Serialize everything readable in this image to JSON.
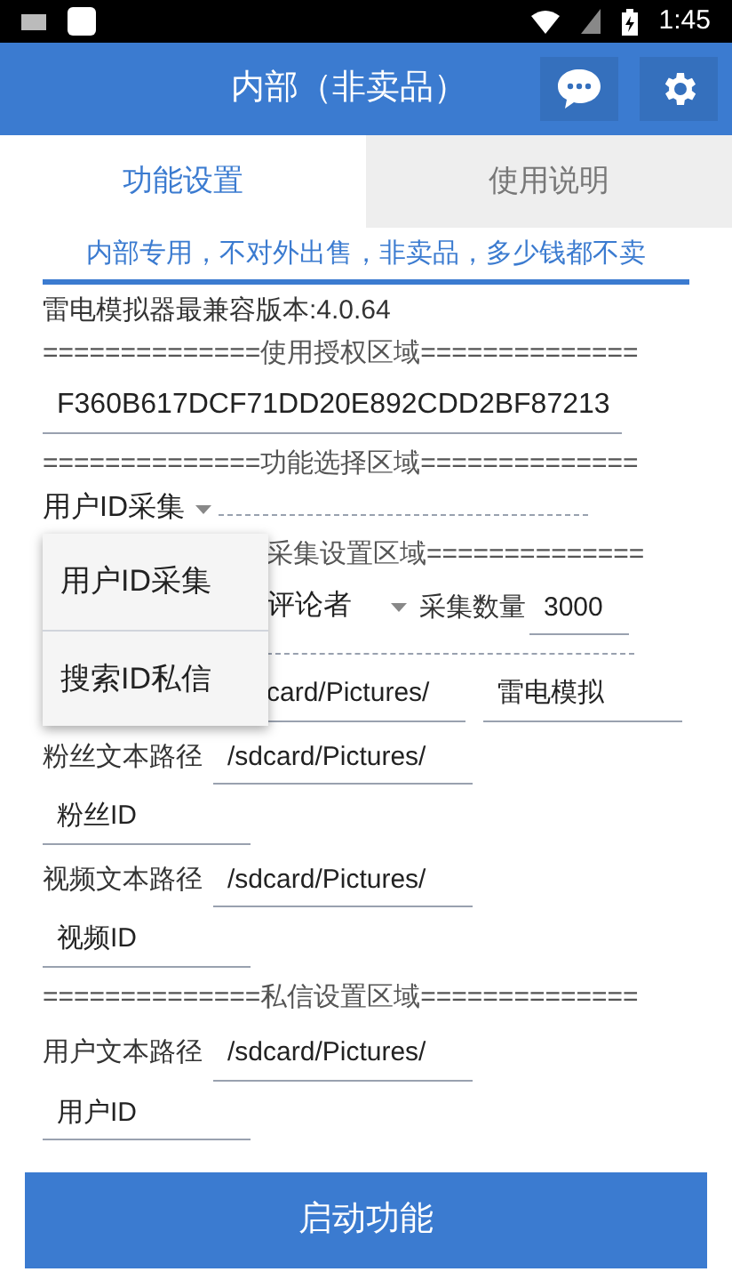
{
  "status_bar": {
    "time": "1:45"
  },
  "header": {
    "title": "内部（非卖品）"
  },
  "tabs": [
    {
      "label": "功能设置",
      "selected": true
    },
    {
      "label": "使用说明",
      "selected": false
    }
  ],
  "notice": "内部专用，不对外出售，非卖品，多少钱都不卖",
  "version": "雷电模拟器最兼容版本:4.0.64",
  "license": {
    "heading": "==============使用授权区域==============",
    "value": "F360B617DCF71DD20E892CDD2BF87213"
  },
  "function": {
    "heading": "==============功能选择区域==============",
    "spinner": "用户ID采集",
    "menu": [
      "用户ID采集",
      "搜索ID私信"
    ]
  },
  "collect": {
    "heading": "采集设置区域==============",
    "spinner": "评论者",
    "count_label": "采集数量",
    "count": "3000",
    "path_value": "card/Pictures/",
    "name_value": "雷电模拟"
  },
  "rows": [
    {
      "kind": "path",
      "label": "粉丝文本路径",
      "value": "/sdcard/Pictures/"
    },
    {
      "kind": "name",
      "value": "粉丝ID"
    },
    {
      "kind": "path",
      "label": "视频文本路径",
      "value": "/sdcard/Pictures/"
    },
    {
      "kind": "name",
      "value": "视频ID"
    },
    {
      "kind": "heading",
      "value": "==============私信设置区域=============="
    },
    {
      "kind": "path",
      "label": "用户文本路径",
      "value": "/sdcard/Pictures/"
    },
    {
      "kind": "name",
      "value": "用户ID"
    }
  ],
  "start_button": "启动功能"
}
